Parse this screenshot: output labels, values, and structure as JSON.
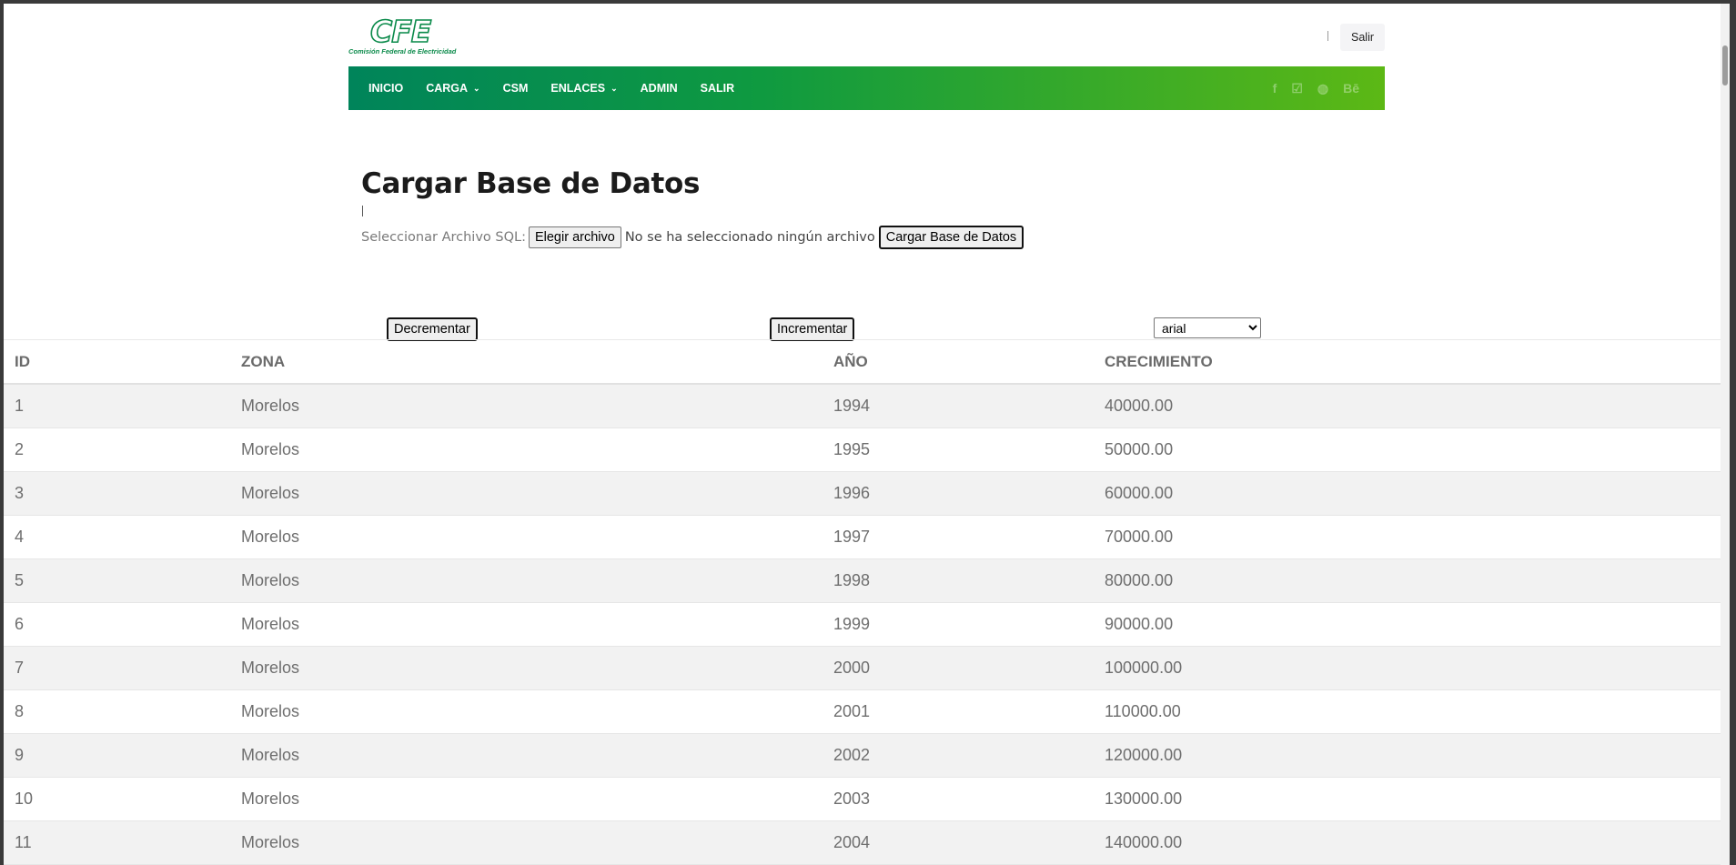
{
  "header": {
    "logo_text": "CFE",
    "logo_subtitle": "Comisión Federal de Electricidad",
    "logout_label": "Salir"
  },
  "nav": {
    "items": [
      {
        "label": "INICIO",
        "has_dropdown": false
      },
      {
        "label": "CARGA",
        "has_dropdown": true
      },
      {
        "label": "CSM",
        "has_dropdown": false
      },
      {
        "label": "ENLACES",
        "has_dropdown": true
      },
      {
        "label": "ADMIN",
        "has_dropdown": false
      },
      {
        "label": "SALIR",
        "has_dropdown": false
      }
    ],
    "caret_glyph": "⌄",
    "social_icons": [
      {
        "name": "facebook-icon",
        "glyph": "f"
      },
      {
        "name": "twitter-icon",
        "glyph": "☑"
      },
      {
        "name": "dribbble-icon",
        "glyph": "◍"
      },
      {
        "name": "behance-icon",
        "glyph": "Bē"
      }
    ],
    "colors": {
      "start": "#00845a",
      "end": "#5cb815"
    }
  },
  "upload": {
    "title": "Cargar Base de Datos",
    "file_label": "Seleccionar Archivo SQL:",
    "choose_file_button": "Elegir archivo",
    "no_file_text": "No se ha seleccionado ningún archivo",
    "submit_button": "Cargar Base de Datos"
  },
  "controls": {
    "decrement_button": "Decrementar",
    "increment_button": "Incrementar",
    "font_select_value": "arial"
  },
  "table": {
    "columns": [
      "ID",
      "ZONA",
      "AÑO",
      "CRECIMIENTO"
    ],
    "rows": [
      [
        "1",
        "Morelos",
        "1994",
        "40000.00"
      ],
      [
        "2",
        "Morelos",
        "1995",
        "50000.00"
      ],
      [
        "3",
        "Morelos",
        "1996",
        "60000.00"
      ],
      [
        "4",
        "Morelos",
        "1997",
        "70000.00"
      ],
      [
        "5",
        "Morelos",
        "1998",
        "80000.00"
      ],
      [
        "6",
        "Morelos",
        "1999",
        "90000.00"
      ],
      [
        "7",
        "Morelos",
        "2000",
        "100000.00"
      ],
      [
        "8",
        "Morelos",
        "2001",
        "110000.00"
      ],
      [
        "9",
        "Morelos",
        "2002",
        "120000.00"
      ],
      [
        "10",
        "Morelos",
        "2003",
        "130000.00"
      ],
      [
        "11",
        "Morelos",
        "2004",
        "140000.00"
      ]
    ]
  }
}
